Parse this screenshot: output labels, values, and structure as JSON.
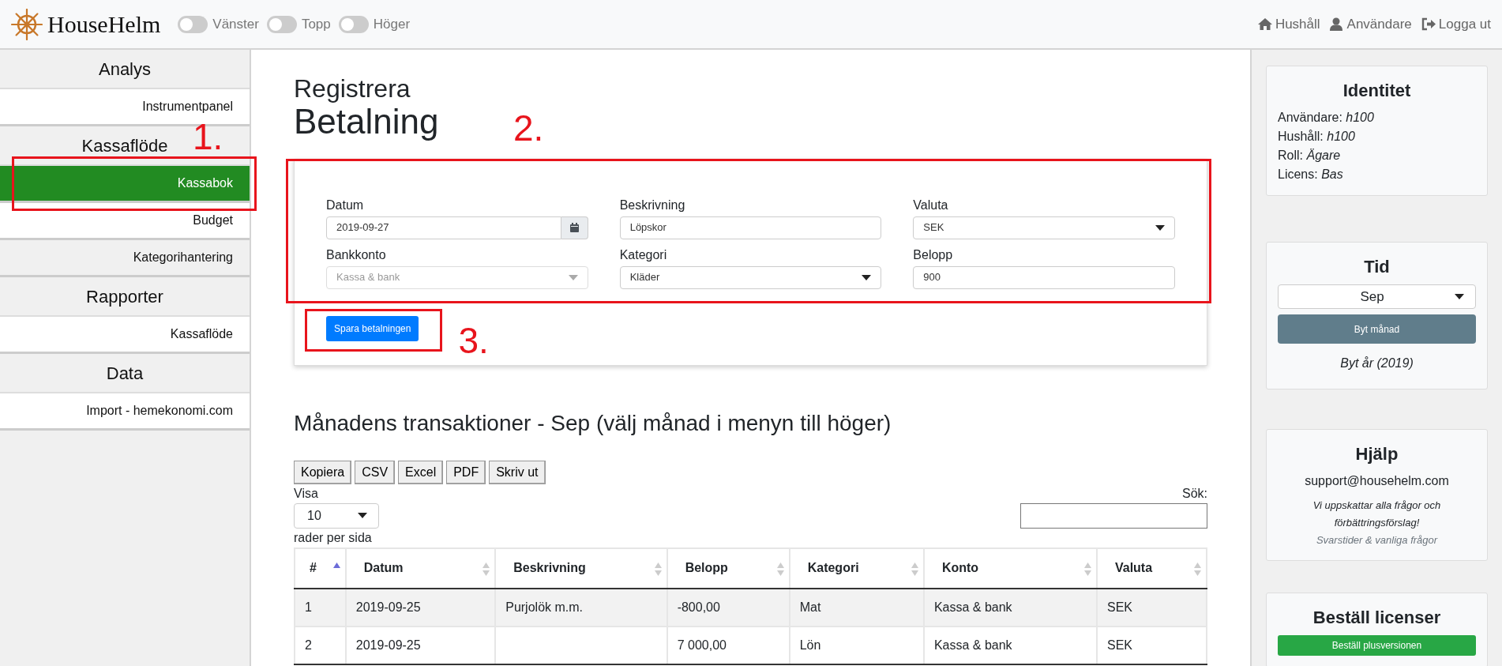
{
  "navbar": {
    "brand": "HouseHelm",
    "toggles": [
      {
        "label": "Vänster",
        "checked": false
      },
      {
        "label": "Topp",
        "checked": false
      },
      {
        "label": "Höger",
        "checked": false
      }
    ],
    "links": [
      {
        "label": "Hushåll"
      },
      {
        "label": "Användare"
      },
      {
        "label": "Logga ut"
      }
    ]
  },
  "sidebar": {
    "sections": [
      {
        "title": "Analys",
        "items": [
          {
            "label": "Instrumentpanel",
            "selected": false,
            "shaded": false
          }
        ]
      },
      {
        "title": "Kassaflöde",
        "items": [
          {
            "label": "Kassabok",
            "selected": true,
            "shaded": false
          },
          {
            "label": "Budget",
            "selected": false,
            "shaded": false
          },
          {
            "label": "Kategorihantering",
            "selected": false,
            "shaded": true
          }
        ]
      },
      {
        "title": "Rapporter",
        "items": [
          {
            "label": "Kassaflöde",
            "selected": false,
            "shaded": false
          }
        ]
      },
      {
        "title": "Data",
        "items": [
          {
            "label": "Import - hemekonomi.com",
            "selected": false,
            "shaded": false
          }
        ]
      }
    ]
  },
  "page": {
    "subtitle": "Registrera",
    "title": "Betalning"
  },
  "form": {
    "fields": [
      {
        "label": "Datum",
        "kind": "date",
        "value": "2019-09-27",
        "disabled": false
      },
      {
        "label": "Beskrivning",
        "kind": "text",
        "value": "Löpskor",
        "disabled": false
      },
      {
        "label": "Valuta",
        "kind": "select",
        "value": "SEK",
        "disabled": false
      },
      {
        "label": "Bankkonto",
        "kind": "select",
        "value": "Kassa & bank",
        "disabled": true
      },
      {
        "label": "Kategori",
        "kind": "select",
        "value": "Kläder",
        "disabled": false
      },
      {
        "label": "Belopp",
        "kind": "text",
        "value": "900",
        "disabled": false
      }
    ],
    "submit": "Spara betalningen"
  },
  "transactions": {
    "title": "Månadens transaktioner - Sep (välj månad i menyn till höger)",
    "export_buttons": [
      "Kopiera",
      "CSV",
      "Excel",
      "PDF",
      "Skriv ut"
    ],
    "length_label": "Visa",
    "length_value": "10",
    "length_suffix": "rader per sida",
    "search_label": "Sök:",
    "table": {
      "columns": [
        {
          "label": "#",
          "sorted": true
        },
        {
          "label": "Datum",
          "sorted": false
        },
        {
          "label": "Beskrivning",
          "sorted": false
        },
        {
          "label": "Belopp",
          "sorted": false
        },
        {
          "label": "Kategori",
          "sorted": false
        },
        {
          "label": "Konto",
          "sorted": false
        },
        {
          "label": "Valuta",
          "sorted": false
        }
      ],
      "rows": [
        [
          "1",
          "2019-09-25",
          "Purjolök m.m.",
          "-800,00",
          "Mat",
          "Kassa & bank",
          "SEK"
        ],
        [
          "2",
          "2019-09-25",
          "",
          "7 000,00",
          "Lön",
          "Kassa & bank",
          "SEK"
        ]
      ]
    }
  },
  "right_panel": {
    "identity": {
      "title": "Identitet",
      "lines": [
        {
          "label": "Användare:",
          "value": "h100"
        },
        {
          "label": "Hushåll:",
          "value": "h100"
        },
        {
          "label": "Roll:",
          "value": "Ägare"
        },
        {
          "label": "Licens:",
          "value": "Bas"
        }
      ]
    },
    "time": {
      "title": "Tid",
      "month": "Sep",
      "button": "Byt månad",
      "year_link": "Byt år (2019)"
    },
    "help": {
      "title": "Hjälp",
      "email": "support@househelm.com",
      "note": "Vi uppskattar alla frågor och förbättringsförslag!",
      "faq_link": "Svarstider & vanliga frågor"
    },
    "license": {
      "title": "Beställ licenser",
      "button": "Beställ plusversionen"
    }
  },
  "annotations": [
    {
      "label": "1."
    },
    {
      "label": "2."
    },
    {
      "label": "3."
    }
  ]
}
